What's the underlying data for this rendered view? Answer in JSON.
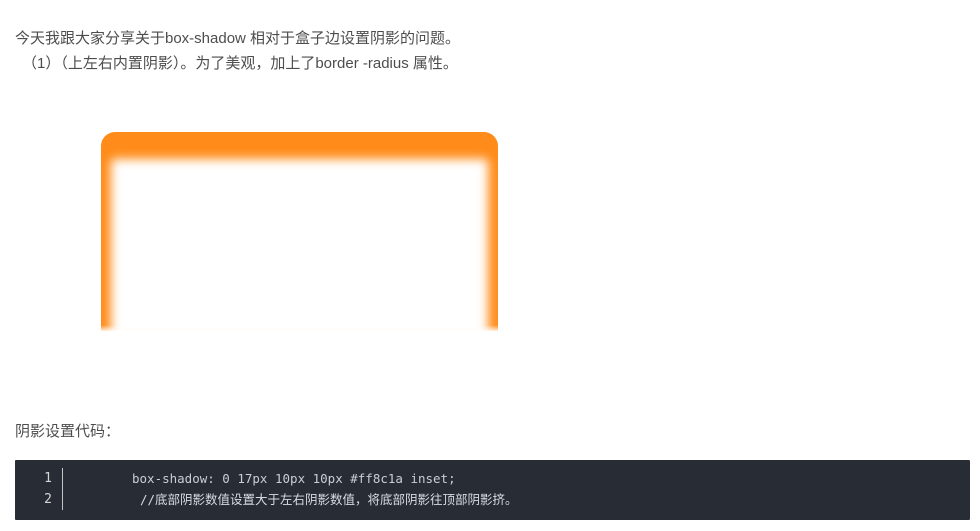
{
  "article": {
    "paragraph1": "今天我跟大家分享关于box-shadow 相对于盒子边设置阴影的问题。",
    "paragraph2": "（1）（上左右内置阴影）。为了美观，加上了border -radius 属性。",
    "paragraph3": "阴影设置代码："
  },
  "demo": {
    "shadow_color": "#ff8c1a"
  },
  "code": {
    "lines": [
      {
        "number": "1",
        "text": "box-shadow: 0 17px 10px 10px #ff8c1a inset;"
      },
      {
        "number": "2",
        "text": "//底部阴影数值设置大于左右阴影数值，将底部阴影往顶部阴影挤。"
      }
    ]
  },
  "colors": {
    "text": "#4d4d4d",
    "code_background": "#282c34",
    "accent_orange": "#ff8c1a"
  }
}
